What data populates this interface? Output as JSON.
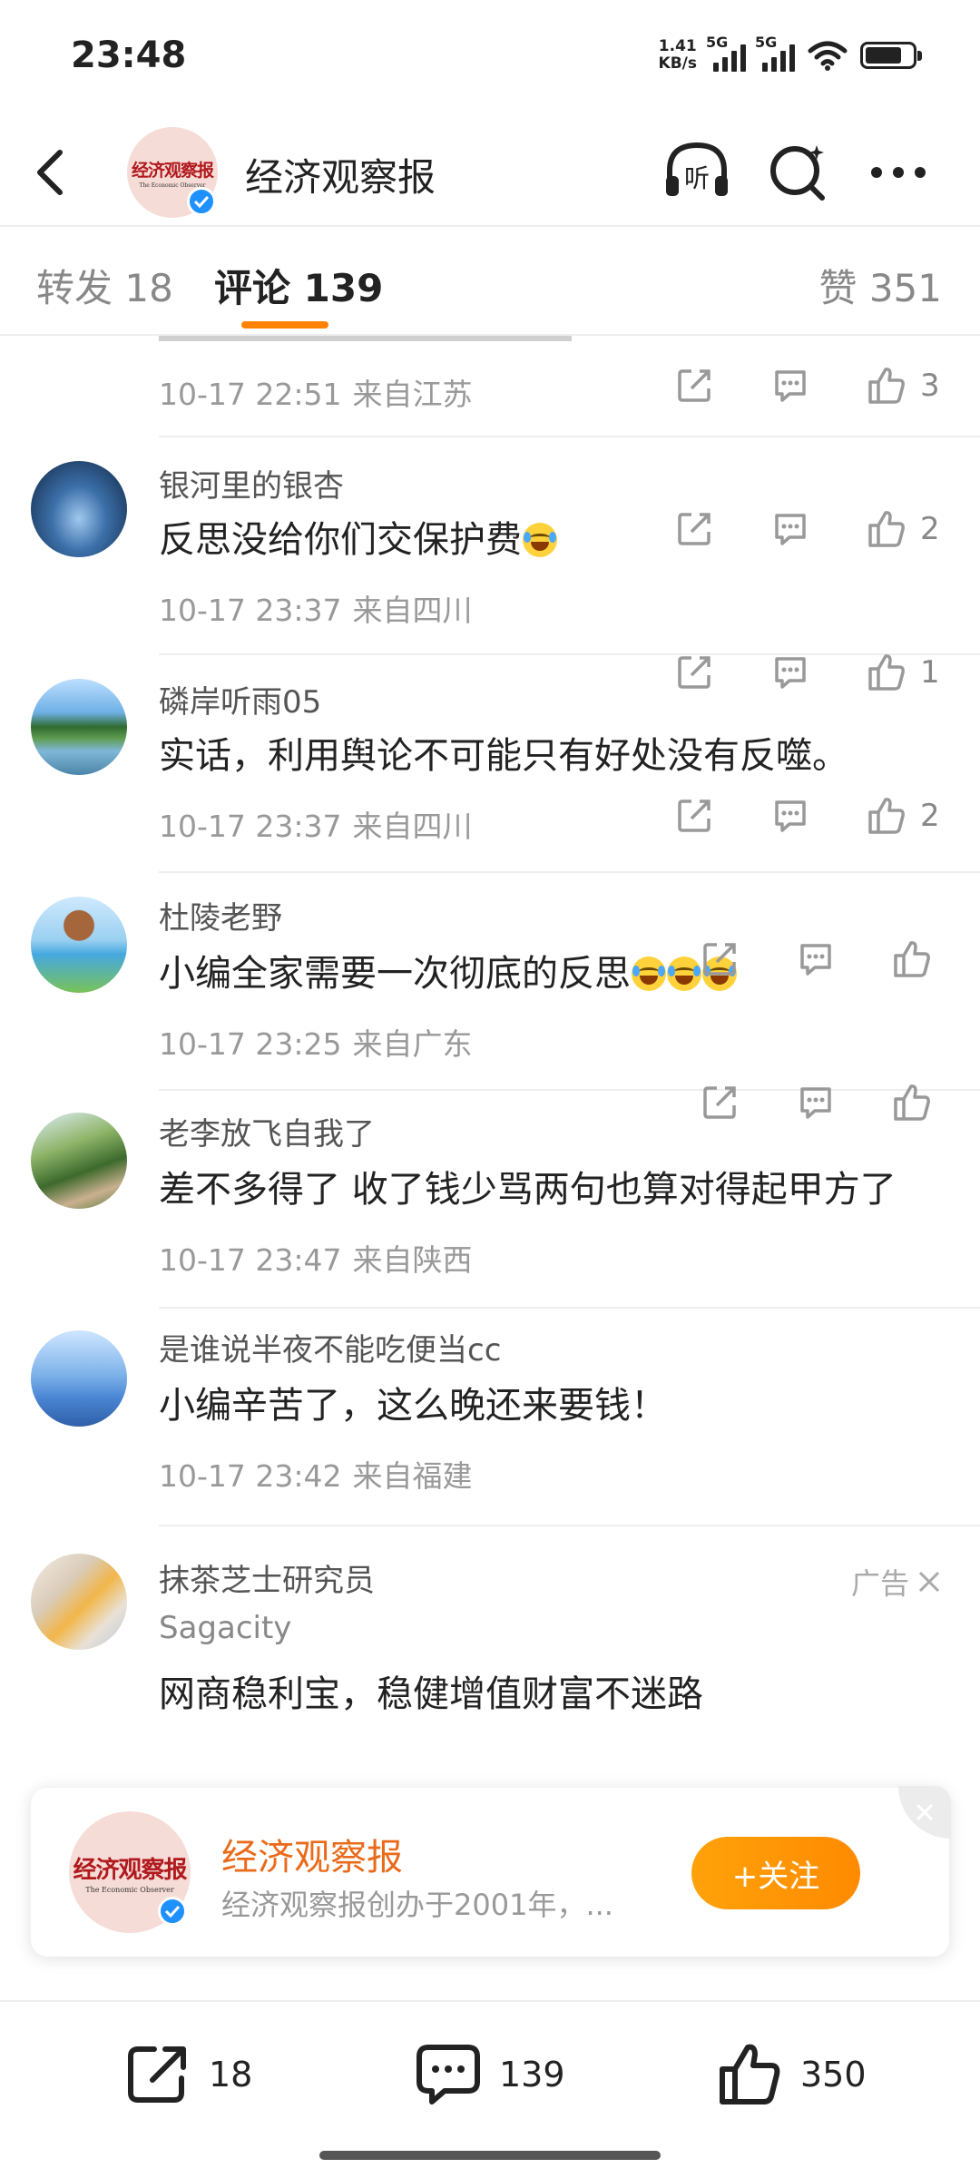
{
  "status_bar": {
    "time": "23:48",
    "speed": "1.41",
    "speed_unit": "KB/s",
    "net1": "5G",
    "net2": "5G"
  },
  "header": {
    "title": "经济观察报",
    "logo_text": "经济观察报",
    "logo_sub": "The Economic Observer"
  },
  "tabs": {
    "repost": "转发 18",
    "comments": "评论 139",
    "likes": "赞 351"
  },
  "comments": [
    {
      "name": "",
      "text": "",
      "date": "10-17 22:51",
      "location": "来自江苏",
      "likes": "3"
    },
    {
      "name": "银河里的银杏",
      "text": "反思没给你们交保护费",
      "date": "10-17 23:37",
      "location": "来自四川",
      "likes": "2"
    },
    {
      "name": "磷岸听雨05",
      "text": "实话，利用舆论不可能只有好处没有反噬。",
      "date": "10-17 23:37",
      "location": "来自四川",
      "likes": "1"
    },
    {
      "name": "杜陵老野",
      "text": "小编全家需要一次彻底的反思",
      "date": "10-17 23:25",
      "location": "来自广东",
      "likes": "2"
    },
    {
      "name": "老李放飞自我了",
      "text": "差不多得了 收了钱少骂两句也算对得起甲方了",
      "date": "10-17 23:47",
      "location": "来自陕西",
      "likes": ""
    },
    {
      "name": "是谁说半夜不能吃便当cc",
      "text": "小编辛苦了，这么晚还来要钱！",
      "date": "10-17 23:42",
      "location": "来自福建",
      "likes": ""
    }
  ],
  "ad": {
    "name": "抹茶芝士研究员",
    "tag": "广告",
    "brand": "Sagacity",
    "text": "网商稳利宝，稳健增值财富不迷路"
  },
  "follow_card": {
    "name": "经济观察报",
    "desc": "经济观察报创办于2001年，...",
    "button": "+关注",
    "logo_text": "经济观察报",
    "logo_sub": "The Economic Observer"
  },
  "bottom_bar": {
    "repost": "18",
    "comments": "139",
    "likes": "350"
  },
  "colors": {
    "accent": "#ff8200",
    "verified": "#1e90ff",
    "card_name": "#e96b1a"
  }
}
